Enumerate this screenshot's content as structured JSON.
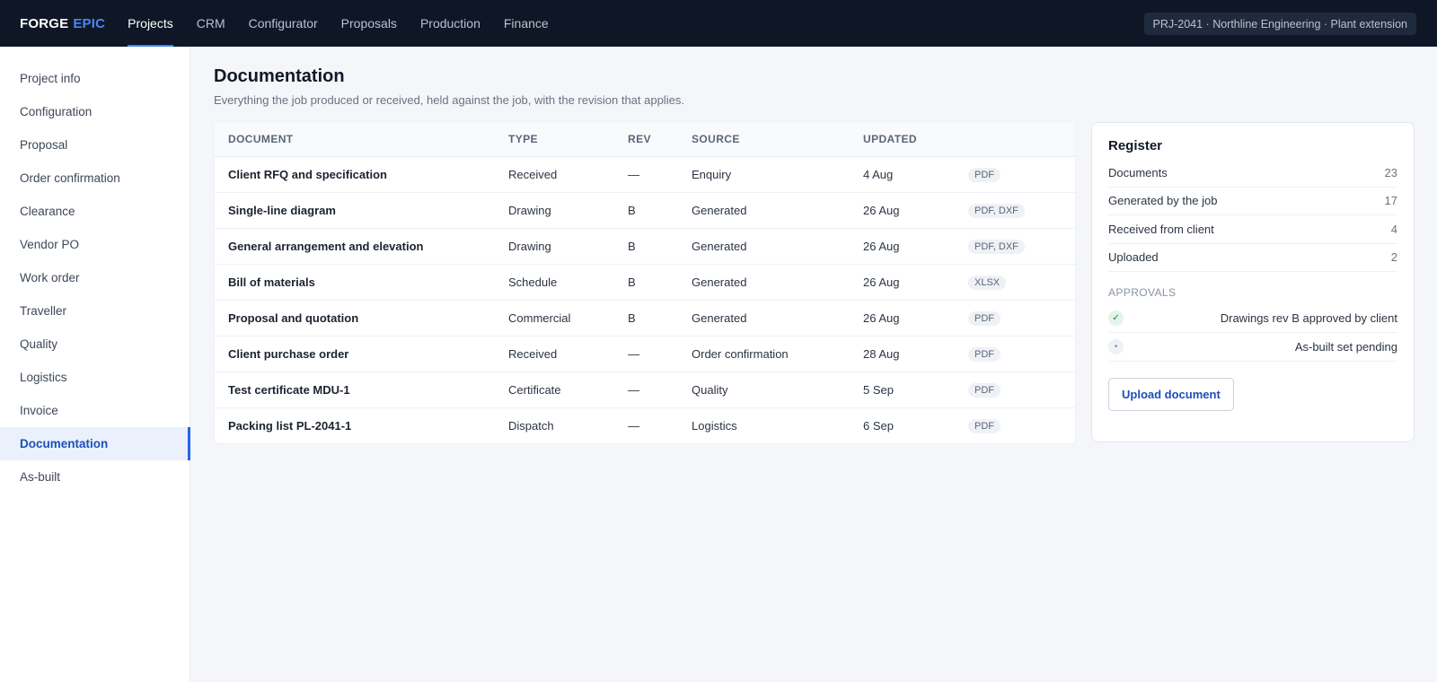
{
  "brand": {
    "name": "FORGE",
    "accent": "EPIC"
  },
  "topnav": [
    {
      "label": "Projects",
      "active": true
    },
    {
      "label": "CRM"
    },
    {
      "label": "Configurator"
    },
    {
      "label": "Proposals"
    },
    {
      "label": "Production"
    },
    {
      "label": "Finance"
    }
  ],
  "project_chip": "PRJ-2041 · Northline Engineering · Plant extension",
  "sidebar": [
    {
      "label": "Project info"
    },
    {
      "label": "Configuration"
    },
    {
      "label": "Proposal"
    },
    {
      "label": "Order confirmation"
    },
    {
      "label": "Clearance"
    },
    {
      "label": "Vendor PO"
    },
    {
      "label": "Work order"
    },
    {
      "label": "Traveller"
    },
    {
      "label": "Quality"
    },
    {
      "label": "Logistics"
    },
    {
      "label": "Invoice"
    },
    {
      "label": "Documentation",
      "active": true
    },
    {
      "label": "As-built"
    }
  ],
  "page": {
    "title": "Documentation",
    "subtitle": "Everything the job produced or received, held against the job, with the revision that applies."
  },
  "table": {
    "headers": [
      "DOCUMENT",
      "TYPE",
      "REV",
      "SOURCE",
      "UPDATED"
    ],
    "rows": [
      {
        "doc": "Client RFQ and specification",
        "type": "Received",
        "rev": "—",
        "source": "Enquiry",
        "updated": "4 Aug",
        "format": "PDF"
      },
      {
        "doc": "Single-line diagram",
        "type": "Drawing",
        "rev": "B",
        "source": "Generated",
        "updated": "26 Aug",
        "format": "PDF, DXF"
      },
      {
        "doc": "General arrangement and elevation",
        "type": "Drawing",
        "rev": "B",
        "source": "Generated",
        "updated": "26 Aug",
        "format": "PDF, DXF"
      },
      {
        "doc": "Bill of materials",
        "type": "Schedule",
        "rev": "B",
        "source": "Generated",
        "updated": "26 Aug",
        "format": "XLSX"
      },
      {
        "doc": "Proposal and quotation",
        "type": "Commercial",
        "rev": "B",
        "source": "Generated",
        "updated": "26 Aug",
        "format": "PDF"
      },
      {
        "doc": "Client purchase order",
        "type": "Received",
        "rev": "—",
        "source": "Order confirmation",
        "updated": "28 Aug",
        "format": "PDF"
      },
      {
        "doc": "Test certificate MDU-1",
        "type": "Certificate",
        "rev": "—",
        "source": "Quality",
        "updated": "5 Sep",
        "format": "PDF"
      },
      {
        "doc": "Packing list PL-2041-1",
        "type": "Dispatch",
        "rev": "—",
        "source": "Logistics",
        "updated": "6 Sep",
        "format": "PDF"
      }
    ]
  },
  "register": {
    "title": "Register",
    "stats": [
      {
        "label": "Documents",
        "value": "23"
      },
      {
        "label": "Generated by the job",
        "value": "17"
      },
      {
        "label": "Received from client",
        "value": "4"
      },
      {
        "label": "Uploaded",
        "value": "2"
      }
    ],
    "approvals_heading": "APPROVALS",
    "approvals": [
      {
        "label": "Drawings rev B approved by client",
        "status": "approved",
        "glyph": "✓"
      },
      {
        "label": "As-built set pending",
        "status": "pending",
        "glyph": "•"
      }
    ],
    "upload_label": "Upload document"
  }
}
